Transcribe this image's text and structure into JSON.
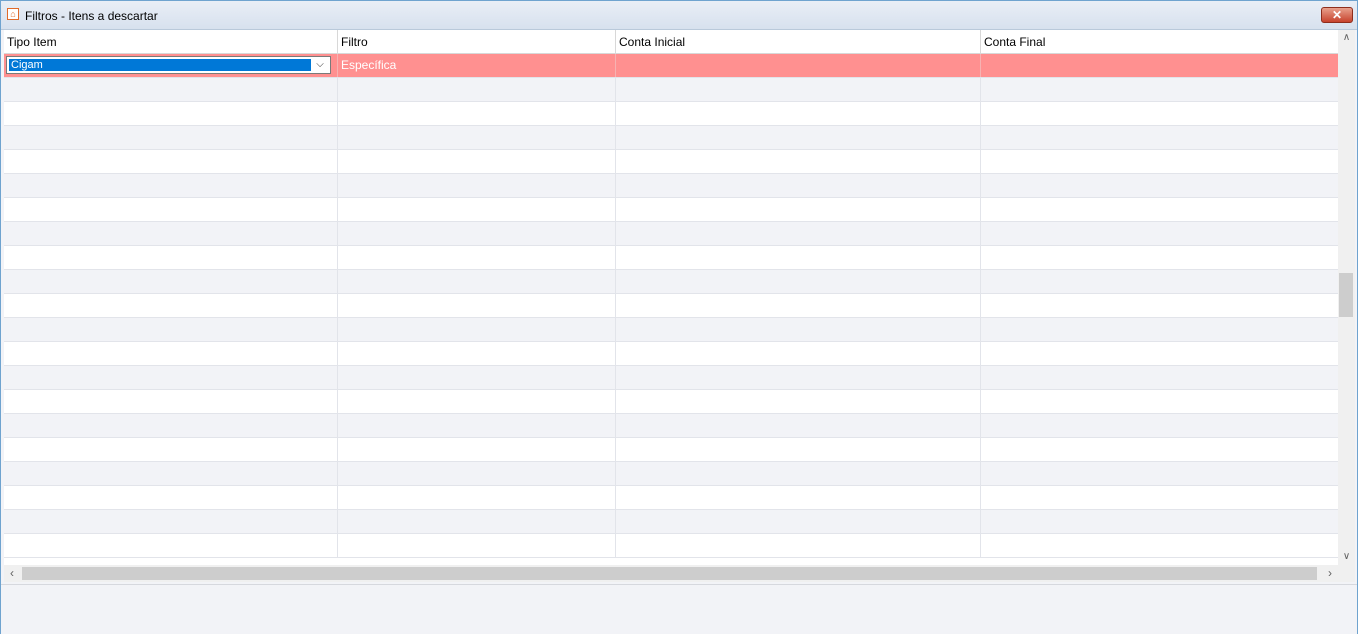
{
  "window": {
    "title": "Filtros - Itens a descartar",
    "close_label": "✕"
  },
  "grid": {
    "columns": [
      "Tipo Item",
      "Filtro",
      "Conta Inicial",
      "Conta Final"
    ],
    "selected_row": {
      "tipo_item": "Cigam",
      "filtro": "Específica",
      "conta_inicial": "",
      "conta_final": ""
    },
    "selected_row_color": "#ff9090",
    "empty_rows": 20
  },
  "icons": {
    "combo": "chevron-down-icon",
    "scroll_up": "chevron-up-icon",
    "scroll_down": "chevron-down-icon",
    "scroll_left": "chevron-left-icon",
    "scroll_right": "chevron-right-icon"
  }
}
